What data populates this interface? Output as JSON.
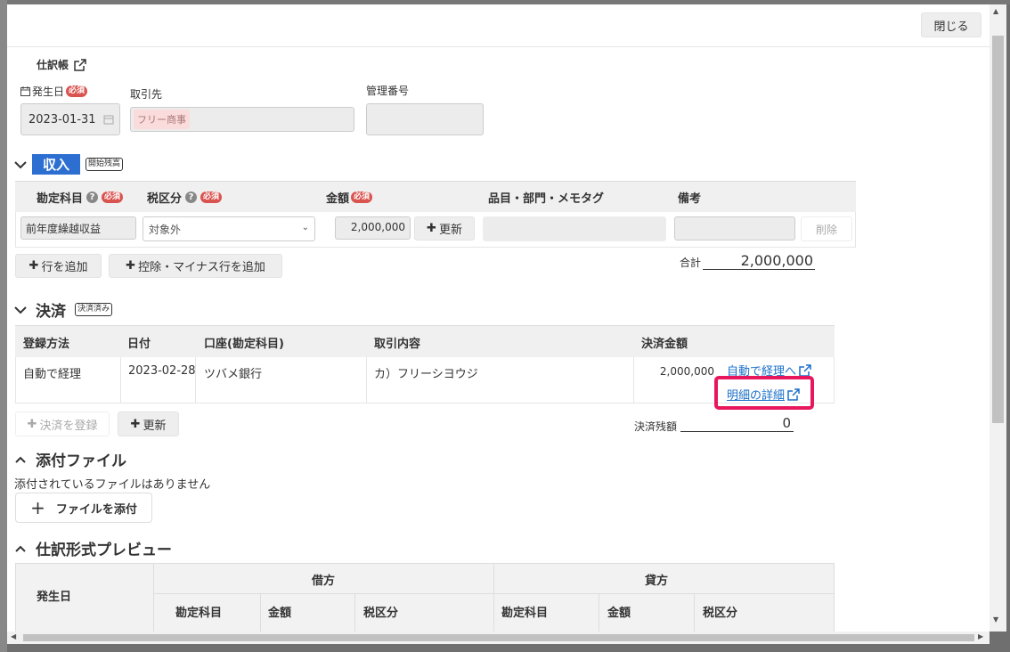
{
  "header": {
    "close_label": "閉じる"
  },
  "ledger": {
    "title": "仕訳帳"
  },
  "fields": {
    "date_label": "発生日",
    "required": "必須",
    "date_value": "2023-01-31",
    "partner_label": "取引先",
    "partner_tag": "フリー商事",
    "mgmt_label": "管理番号"
  },
  "income": {
    "title": "収入",
    "badge": "開始残高",
    "col_account": "勘定科目",
    "col_tax": "税区分",
    "col_amount": "金額",
    "col_item": "品目・部門・メモタグ",
    "col_note": "備考",
    "row_account": "前年度繰越収益",
    "row_tax": "対象外",
    "row_amount": "2,000,000",
    "update_label": "更新",
    "delete_label": "削除",
    "add_row_label": "行を追加",
    "add_minus_label": "控除・マイナス行を追加",
    "total_label": "合計",
    "total_value": "2,000,000"
  },
  "settlement": {
    "title": "決済",
    "badge": "決済済み",
    "col_method": "登録方法",
    "col_date": "日付",
    "col_account": "口座(勘定科目)",
    "col_content": "取引内容",
    "col_amount": "決済金額",
    "row_method": "自動で経理",
    "row_date": "2023-02-28",
    "row_account": "ツバメ銀行",
    "row_content": "カ）フリーシヨウジ",
    "row_amount": "2,000,000",
    "link_auto": "自動で経理へ",
    "link_detail": "明細の詳細",
    "register_label": "決済を登録",
    "update_label": "更新",
    "balance_label": "決済残額",
    "balance_value": "0"
  },
  "attachments": {
    "title": "添付ファイル",
    "empty_text": "添付されているファイルはありません",
    "attach_label": "ファイルを添付"
  },
  "preview": {
    "title": "仕訳形式プレビュー",
    "col_date": "発生日",
    "debit": "借方",
    "credit": "貸方",
    "sub_account": "勘定科目",
    "sub_amount": "金額",
    "sub_tax": "税区分"
  },
  "colors": {
    "accent": "#2c6fd1",
    "highlight": "#e8175d",
    "link": "#1a6fc9"
  }
}
